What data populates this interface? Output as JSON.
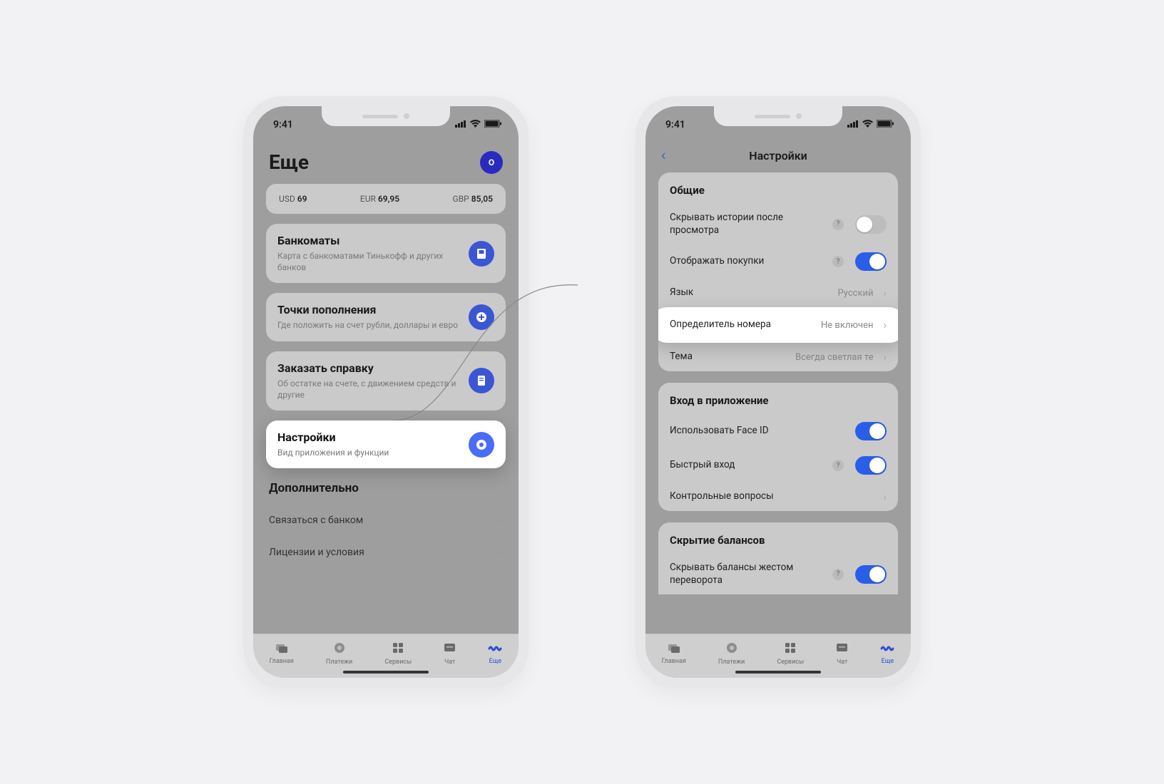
{
  "status_time": "9:41",
  "left": {
    "page_title": "Еще",
    "rates": [
      {
        "code": "USD",
        "value": "69"
      },
      {
        "code": "EUR",
        "value": "69,95"
      },
      {
        "code": "GBP",
        "value": "85,05"
      }
    ],
    "cards": [
      {
        "title": "Банкоматы",
        "sub": "Карта с банкоматами Тинькофф и других банков",
        "icon": "atm"
      },
      {
        "title": "Точки пополнения",
        "sub": "Где положить на счет рубли, доллары и евро",
        "icon": "plus"
      },
      {
        "title": "Заказать справку",
        "sub": "Об остатке на счете, с движением средств и другие",
        "icon": "doc"
      },
      {
        "title": "Настройки",
        "sub": "Вид приложения и функции",
        "icon": "gear",
        "highlight": true
      }
    ],
    "extra_header": "Дополнительно",
    "extra_rows": [
      "Связаться с банком",
      "Лицензии и условия"
    ]
  },
  "right": {
    "header_title": "Настройки",
    "group1": {
      "title": "Общие",
      "rows": [
        {
          "label": "Скрывать истории после просмотра",
          "help": true,
          "toggle": "off"
        },
        {
          "label": "Отображать покупки",
          "help": true,
          "toggle": "on"
        },
        {
          "label": "Язык",
          "value": "Русский"
        },
        {
          "label": "Определитель номера",
          "value": "Не включен",
          "highlight": true
        },
        {
          "label": "Тема",
          "value": "Всегда светлая те"
        }
      ]
    },
    "group2": {
      "title": "Вход в приложение",
      "rows": [
        {
          "label": "Использовать Face ID",
          "toggle": "on"
        },
        {
          "label": "Быстрый вход",
          "help": true,
          "toggle": "on"
        },
        {
          "label": "Контрольные вопросы",
          "chevron": true
        }
      ]
    },
    "group3": {
      "title": "Скрытие балансов",
      "rows": [
        {
          "label": "Скрывать балансы жестом переворота",
          "help": true,
          "toggle": "on"
        }
      ]
    }
  },
  "nav": [
    {
      "label": "Главная",
      "icon": "home"
    },
    {
      "label": "Платежи",
      "icon": "payments"
    },
    {
      "label": "Сервисы",
      "icon": "services"
    },
    {
      "label": "Чат",
      "icon": "chat"
    },
    {
      "label": "Еще",
      "icon": "more",
      "active": true
    }
  ],
  "avatar_letter": "О"
}
